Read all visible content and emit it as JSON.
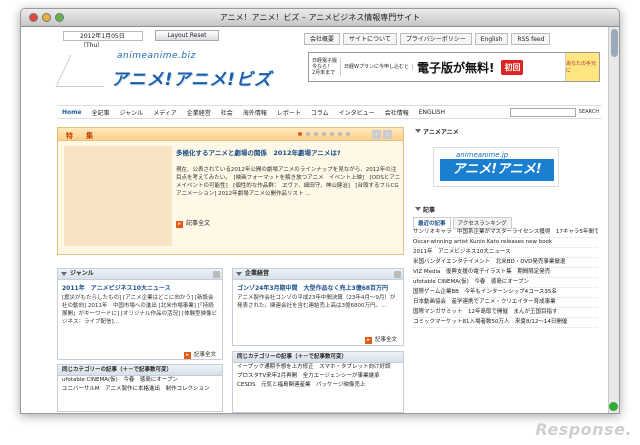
{
  "window": {
    "title": "アニメ！アニメ！ビズ – アニメビジネス情報専門サイト"
  },
  "header": {
    "date": "2012年1月05日（Thu）",
    "layout_reset": "Layout Reset",
    "links": [
      "会社概要",
      "サイトについて",
      "プライバシーポリシー",
      "English",
      "RSS feed"
    ],
    "logo_sub": "animeanime.biz",
    "logo_main": "アニメ!アニメ!ビズ"
  },
  "banner": {
    "left_lines": [
      "日経電子版",
      "今なら！",
      "2月末まで"
    ],
    "mid": "日経Wプランに今申し込むと",
    "big": "電子版が無料!",
    "badge": "初回",
    "char": "あなたの手元に"
  },
  "nav": {
    "items": [
      "Home",
      "全記事",
      "ジャンル",
      "メディア",
      "企業経営",
      "社会",
      "海外情報",
      "レポート",
      "コラム",
      "インタビュー",
      "会社情報",
      "ENGLISH"
    ],
    "search_label": "SEARCH"
  },
  "feature": {
    "title": "特　集",
    "headline": "多極化するアニメと劇場の関係　2012年劇場アニメは?",
    "body": "現在、公表されている2012年公開の劇場アニメのラインナップを見ながら、2012年の注目点を考えてみたい。　[映画フォーマットを解き放つアニメ　イベント上映]　[ODSとアニメイベントの可能性]　[個性的な作品群：　ヱヴァ、細田守、神山健治]　[台頭するフルCGアニメーション] 2012年劇場アニメ公開作品リスト …",
    "more": "記事全文"
  },
  "genre": {
    "title": "ジャンル",
    "headline": "2011年　アニメビジネス10大ニュース",
    "body": "[震災がもたらしたもの] [アニメ企業はどこに向かう] [新設会社の動向] 2011年　中国市場への進出 [北米市場事業] [「持続展開」がキーワードに] [オリジナル作品の活況] [体験型映像ビジネス：ライブ配信]…",
    "more": "記事全文"
  },
  "keiei": {
    "title": "企業経営",
    "headline": "ゴンゾ24年3月期中間　大型作品なく売上3億68百万円",
    "body": "アニメ製作会社ゴンゾの平成23年中間決算（23年4月〜9月）が発表された。関連会社を含む連結売上高は3億6800万円。…",
    "more": "記事全文"
  },
  "sub1": {
    "title": "同じカテゴリーの記事（＋－で記事数可変）",
    "items": [
      "ufotable CINEMA(仮)　今春　徳島にオープン",
      "ユニバーサルM　アニメ製作に本格進出　制作コレクション"
    ]
  },
  "sub2": {
    "title": "同じカテゴリーの記事（＋－で記事数可変）",
    "items": [
      "イーブック通期予想を上方修正　スマホ・タブレット向け好調",
      "プロスタTV来年2月再開　全力エージェンシーが事業継承",
      "CESDS　元気と福島関連産業　パッケージ映像売上"
    ]
  },
  "right": {
    "anime_title": "アニメアニメ",
    "anime_logo_sub": "animeanime.jp",
    "anime_logo_main": "アニメ!アニメ!",
    "kiji_title": "記事",
    "tabs": [
      "最近の記事",
      "アクセスランキング"
    ],
    "items": [
      "サンリオキャラ　中国系企業がマスターライセンス獲得　17キャラ5年間で67億円",
      "Oscar-winning artist Kunio Kato releases new book",
      "2011年　アニメビジネス10大ニュース",
      "米国バンダイエンタテイメント　北米BD・DVD発売事業撤退",
      "VIZ Media　復興支援の電子イラスト集　期間限定発売",
      "ufotable CINEMA(仮)　今春　徳島にオープン",
      "国際ゲーム企業BB　今年もインターンシップ4コース35名",
      "日本動画協会　産学連携でアニメ・クリエイター育成事業",
      "国際マンガサミット　12年島取で開催　まんが王国目指す",
      "コミックマーケット81入場者数50万人　来夏8/12〜14日開催"
    ],
    "ad_title": "広告"
  },
  "watermark": "Response."
}
